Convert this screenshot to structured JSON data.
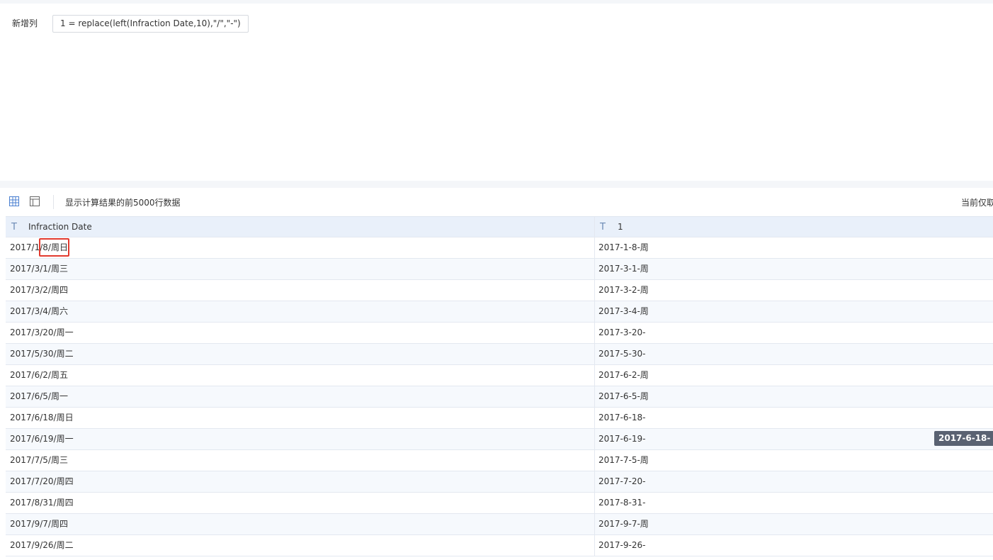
{
  "formula": {
    "label": "新增列",
    "expression": "1 = replace(left(Infraction Date,10),\"/\",\"-\")"
  },
  "toolbar": {
    "info": "显示计算结果的前5000行数据",
    "right_text": "当前仅取"
  },
  "table": {
    "column_type_icon": "T",
    "columns": [
      "Infraction Date",
      "1"
    ],
    "rows": [
      [
        "2017/1/8/周日",
        "2017-1-8-周"
      ],
      [
        "2017/3/1/周三",
        "2017-3-1-周"
      ],
      [
        "2017/3/2/周四",
        "2017-3-2-周"
      ],
      [
        "2017/3/4/周六",
        "2017-3-4-周"
      ],
      [
        "2017/3/20/周一",
        "2017-3-20-"
      ],
      [
        "2017/5/30/周二",
        "2017-5-30-"
      ],
      [
        "2017/6/2/周五",
        "2017-6-2-周"
      ],
      [
        "2017/6/5/周一",
        "2017-6-5-周"
      ],
      [
        "2017/6/18/周日",
        "2017-6-18-"
      ],
      [
        "2017/6/19/周一",
        "2017-6-19-"
      ],
      [
        "2017/7/5/周三",
        "2017-7-5-周"
      ],
      [
        "2017/7/20/周四",
        "2017-7-20-"
      ],
      [
        "2017/8/31/周四",
        "2017-8-31-"
      ],
      [
        "2017/9/7/周四",
        "2017-9-7-周"
      ],
      [
        "2017/9/26/周二",
        "2017-9-26-"
      ]
    ]
  },
  "tooltip": "2017-6-18-",
  "icons": {
    "grid_view": "table-grid-icon",
    "layout_view": "layout-panel-icon",
    "column_type": "text-type-icon"
  },
  "colors": {
    "accent": "#4a7fd0",
    "header_bg": "#e9f0fa",
    "highlight": "#e23a2e",
    "tooltip_bg": "#5a6272"
  }
}
